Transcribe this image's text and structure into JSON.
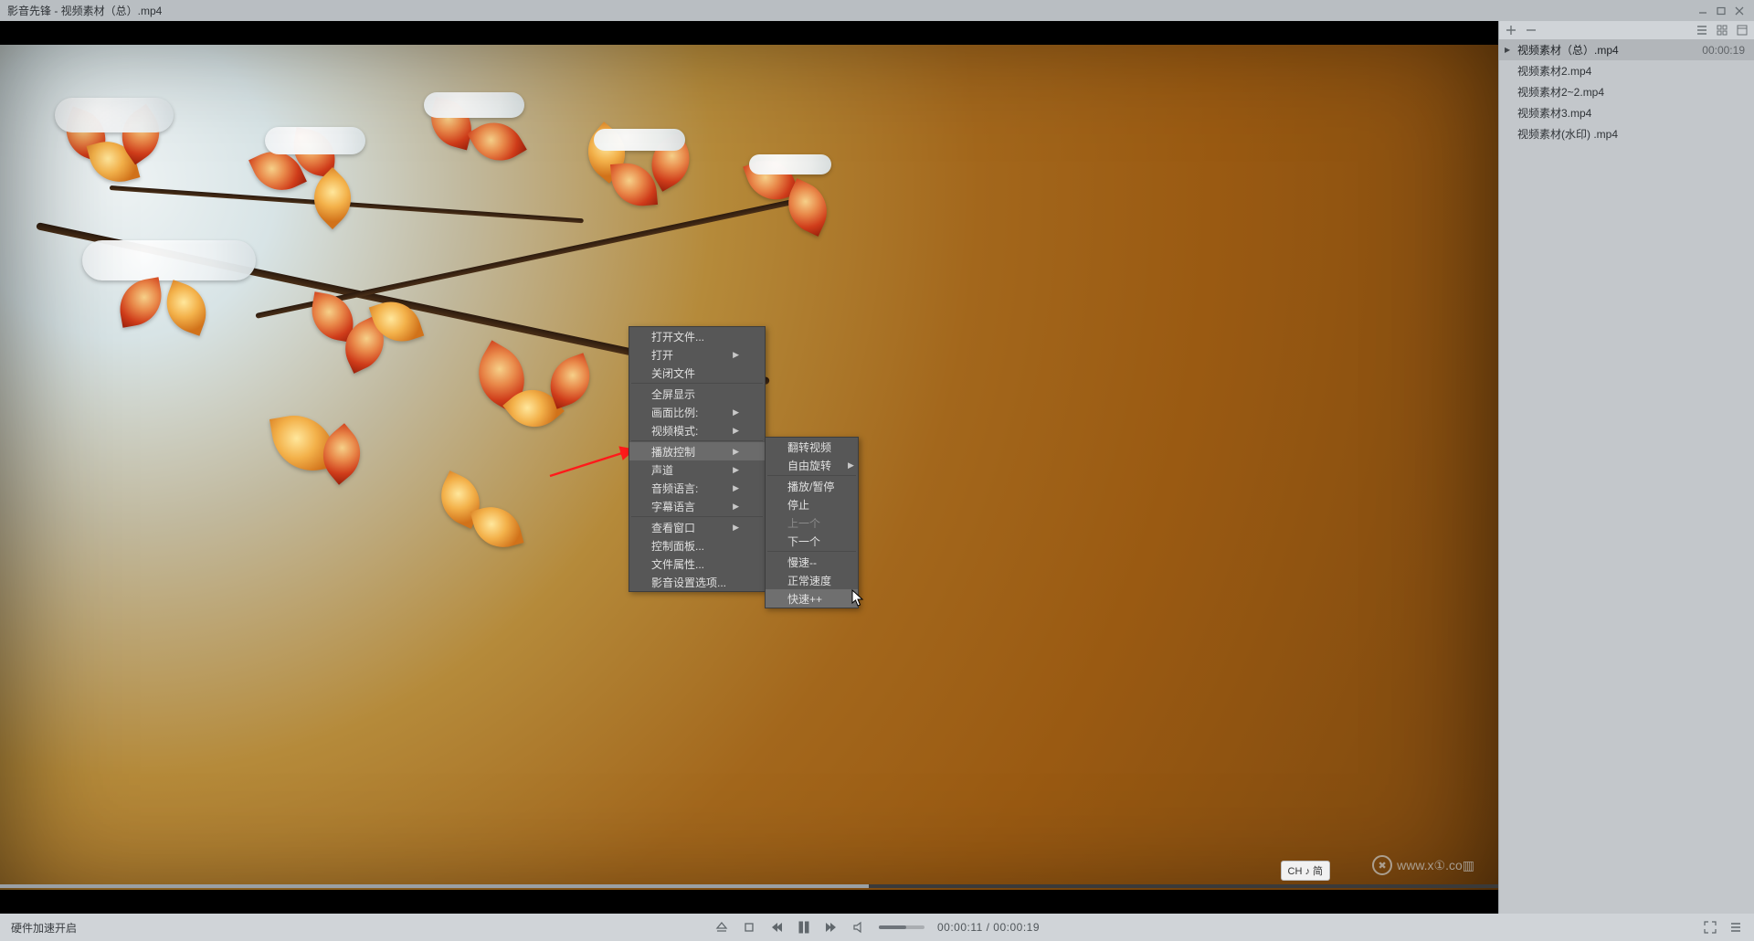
{
  "app": {
    "title": "影音先锋 - 视频素材（总）.mp4"
  },
  "playlist": {
    "items": [
      {
        "name": "视频素材（总）.mp4",
        "duration": "00:00:19",
        "selected": true
      },
      {
        "name": "视频素材2.mp4"
      },
      {
        "name": "视频素材2~2.mp4"
      },
      {
        "name": "视频素材3.mp4"
      },
      {
        "name": "视频素材(水印) .mp4"
      }
    ]
  },
  "context_menu": {
    "items": [
      {
        "label": "打开文件..."
      },
      {
        "label": "打开",
        "submenu": true
      },
      {
        "label": "关闭文件",
        "sep_after": true
      },
      {
        "label": "全屏显示"
      },
      {
        "label": "画面比例:",
        "submenu": true
      },
      {
        "label": "视频模式:",
        "submenu": true,
        "sep_after": true
      },
      {
        "label": "播放控制",
        "submenu": true,
        "selected": true
      },
      {
        "label": "声道",
        "submenu": true
      },
      {
        "label": "音频语言:",
        "submenu": true
      },
      {
        "label": "字幕语言",
        "submenu": true,
        "sep_after": true
      },
      {
        "label": "查看窗口",
        "submenu": true
      },
      {
        "label": "控制面板..."
      },
      {
        "label": "文件属性..."
      },
      {
        "label": "影音设置选项..."
      }
    ]
  },
  "submenu": {
    "items": [
      {
        "label": "翻转视频"
      },
      {
        "label": "自由旋转",
        "submenu": true,
        "sep_after": true
      },
      {
        "label": "播放/暂停"
      },
      {
        "label": "停止"
      },
      {
        "label": "上一个",
        "disabled": true
      },
      {
        "label": "下一个",
        "sep_after": true
      },
      {
        "label": "慢速--"
      },
      {
        "label": "正常速度"
      },
      {
        "label": "快速++",
        "highlight": true
      }
    ]
  },
  "controls": {
    "hw_status": "硬件加速开启",
    "time_current": "00:00:11",
    "time_total": "00:00:19",
    "time_display": "00:00:11 / 00:00:19",
    "progress_pct": 58
  },
  "overlay": {
    "ch_badge": "CH ♪ 简",
    "watermark_text": "www.x①.co▥"
  }
}
